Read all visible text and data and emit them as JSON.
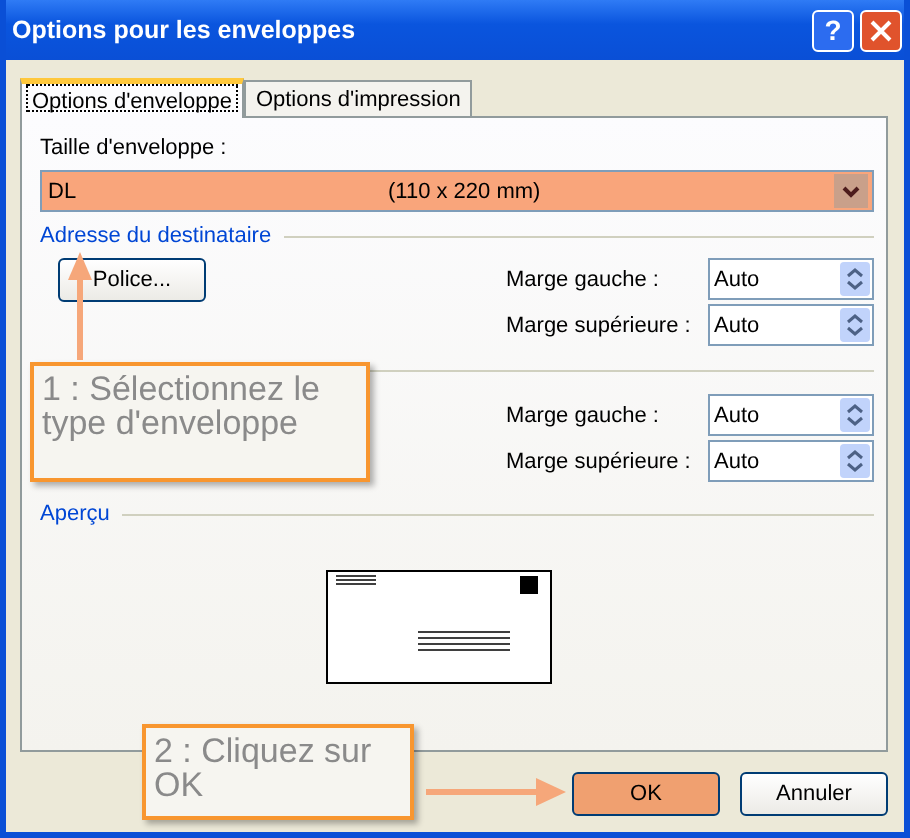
{
  "window": {
    "title": "Options pour les enveloppes",
    "help": "?"
  },
  "tabs": [
    {
      "label": "Options d'enveloppe",
      "selected": true
    },
    {
      "label": "Options d'impression",
      "selected": false
    }
  ],
  "envelope_size": {
    "label": "Taille d'enveloppe :",
    "name": "DL",
    "size": "(110 x 220 mm)",
    "highlighted": true
  },
  "sections": [
    {
      "title": "Adresse du destinataire",
      "button": "Police...",
      "margins": [
        {
          "label": "Marge gauche :",
          "value": "Auto"
        },
        {
          "label": "Marge supérieure :",
          "value": "Auto"
        }
      ]
    },
    {
      "margins": [
        {
          "label": "Marge gauche :",
          "value": "Auto"
        },
        {
          "label": "Marge supérieure :",
          "value": "Auto"
        }
      ]
    }
  ],
  "preview": {
    "title": "Aperçu"
  },
  "buttons": [
    {
      "label": "OK",
      "highlighted": true
    },
    {
      "label": "Annuler",
      "highlighted": false
    }
  ],
  "callouts": [
    {
      "text": "1 : Sélectionnez le type d'enveloppe"
    },
    {
      "text": "2 : Cliquez sur OK"
    }
  ]
}
